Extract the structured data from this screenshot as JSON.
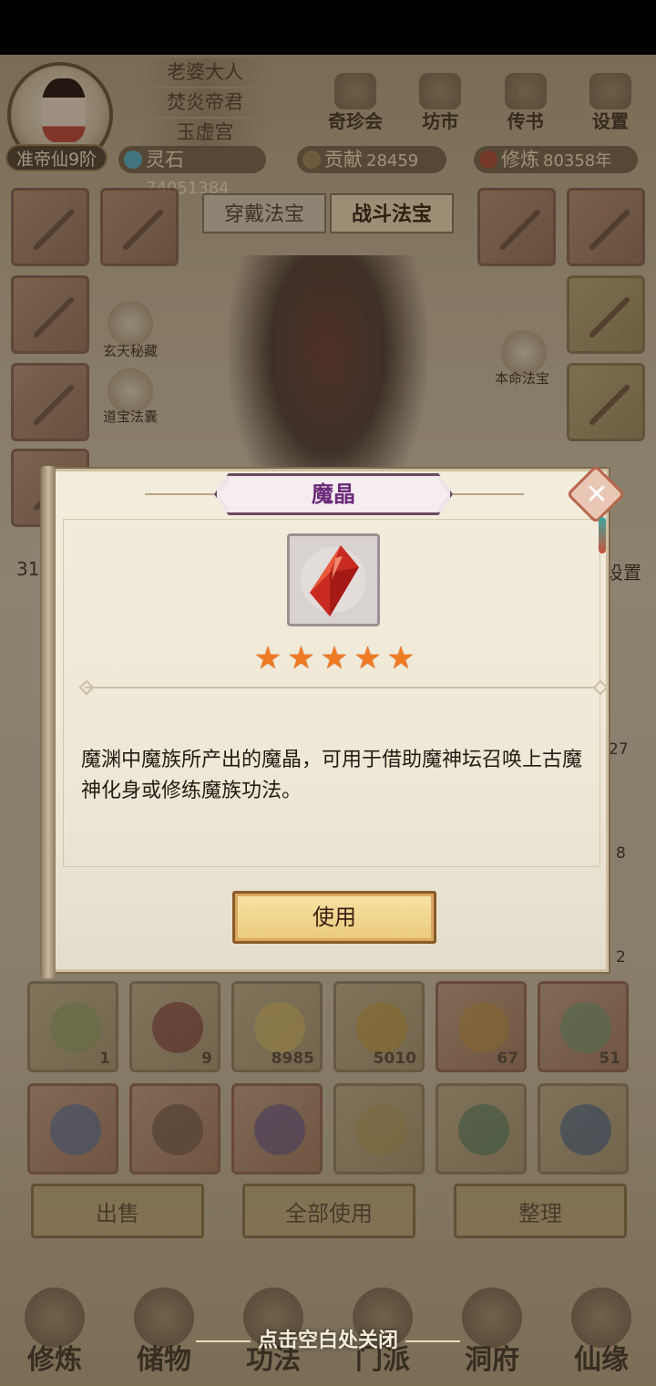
{
  "header": {
    "realm": "准帝仙9阶",
    "names": [
      "老婆大人",
      "焚炎帝君",
      "玉虚宫"
    ],
    "menu": [
      {
        "label": "奇珍会",
        "icon": "treasure-hall-icon"
      },
      {
        "label": "坊市",
        "icon": "market-icon"
      },
      {
        "label": "传书",
        "icon": "letter-icon"
      },
      {
        "label": "设置",
        "icon": "gear-icon"
      }
    ],
    "resources": {
      "lingshi_label": "灵石",
      "lingshi_value": "74051384",
      "gongxian_label": "贡献",
      "gongxian_value": "28459",
      "xiulian_label": "修炼",
      "xiulian_value": "80358年"
    }
  },
  "equipment": {
    "tabs": [
      "穿戴法宝",
      "战斗法宝"
    ],
    "active_tab": "战斗法宝",
    "side_labels": [
      "玄天秘藏",
      "道宝法囊",
      "本命法宝"
    ],
    "partial_left": "31",
    "partial_right": "设置"
  },
  "bag": {
    "counts": [
      "1",
      "9",
      "8985",
      "5010",
      "67",
      "51"
    ],
    "partial_counts": [
      "27",
      "8",
      "2"
    ],
    "actions": [
      "出售",
      "全部使用",
      "整理"
    ]
  },
  "bottom_nav": [
    "修炼",
    "储物",
    "功法",
    "门派",
    "洞府",
    "仙缘"
  ],
  "close_hint": "点击空白处关闭",
  "dialog": {
    "title": "魔晶",
    "item_icon": "red-crystal-icon",
    "stars": 5,
    "description": "魔渊中魔族所产出的魔晶，可用于借助魔神坛召唤上古魔神化身或修练魔族功法。",
    "use_label": "使用",
    "colors": {
      "title": "#6a2a7a",
      "star": "#f07a24",
      "crystal": "#e0392a"
    }
  }
}
